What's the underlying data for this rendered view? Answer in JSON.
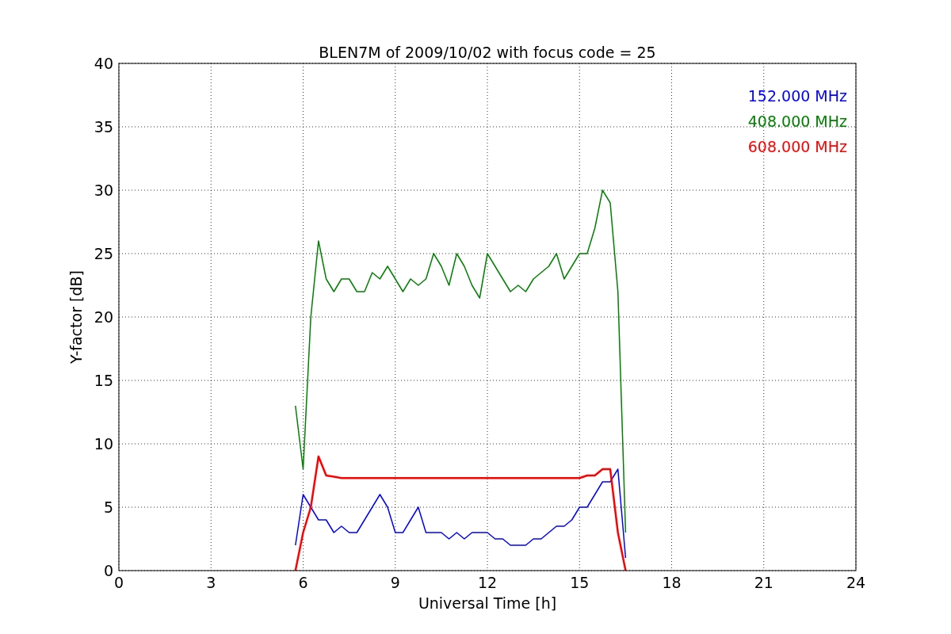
{
  "figure": {
    "chart_data": {
      "type": "line",
      "title": "BLEN7M of 2009/10/02 with focus code = 25",
      "xlabel": "Universal Time [h]",
      "ylabel": "Y-factor [dB]",
      "x": [
        5.75,
        6,
        6.25,
        6.5,
        6.75,
        7,
        7.25,
        7.5,
        7.75,
        8,
        8.25,
        8.5,
        8.75,
        9,
        9.25,
        9.5,
        9.75,
        10,
        10.25,
        10.5,
        10.75,
        11,
        11.25,
        11.5,
        11.75,
        12,
        12.25,
        12.5,
        12.75,
        13,
        13.25,
        13.5,
        13.75,
        14,
        14.25,
        14.5,
        14.75,
        15,
        15.25,
        15.5,
        15.75,
        16,
        16.25,
        16.5
      ],
      "series": [
        {
          "name": "152.000 MHz",
          "color": "#0000ff",
          "values": [
            2,
            6,
            5,
            4,
            4,
            3,
            3.5,
            3,
            3,
            4,
            5,
            6,
            5,
            3,
            3,
            4,
            5,
            3,
            3,
            3,
            2.5,
            3,
            2.5,
            3,
            3,
            3,
            2.5,
            2.5,
            2,
            2,
            2,
            2.5,
            2.5,
            3,
            3.5,
            3.5,
            4,
            5,
            5,
            6,
            7,
            7,
            8,
            1
          ]
        },
        {
          "name": "408.000 MHz",
          "color": "#008000",
          "values": [
            13,
            8,
            20,
            26,
            23,
            22,
            23,
            23,
            22,
            22,
            23.5,
            23,
            24,
            23,
            22,
            23,
            22.5,
            23,
            25,
            24,
            22.5,
            25,
            24,
            22.5,
            21.5,
            25,
            24,
            23,
            22,
            22.5,
            22,
            23,
            23.5,
            24,
            25,
            23,
            24,
            25,
            25,
            27,
            30,
            29,
            22,
            3
          ]
        },
        {
          "name": "608.000 MHz",
          "color": "#ff0000",
          "values": [
            0,
            3,
            5,
            9,
            7.5,
            7.4,
            7.3,
            7.3,
            7.3,
            7.3,
            7.3,
            7.3,
            7.3,
            7.3,
            7.3,
            7.3,
            7.3,
            7.3,
            7.3,
            7.3,
            7.3,
            7.3,
            7.3,
            7.3,
            7.3,
            7.3,
            7.3,
            7.3,
            7.3,
            7.3,
            7.3,
            7.3,
            7.3,
            7.3,
            7.3,
            7.3,
            7.3,
            7.3,
            7.5,
            7.5,
            8,
            8,
            3,
            0
          ]
        }
      ],
      "grid": true,
      "xlim": [
        0,
        24
      ],
      "ylim": [
        0,
        40
      ],
      "xticks": [
        0,
        3,
        6,
        9,
        12,
        15,
        18,
        21,
        24
      ],
      "yticks": [
        0,
        5,
        10,
        15,
        20,
        25,
        30,
        35,
        40
      ]
    }
  }
}
